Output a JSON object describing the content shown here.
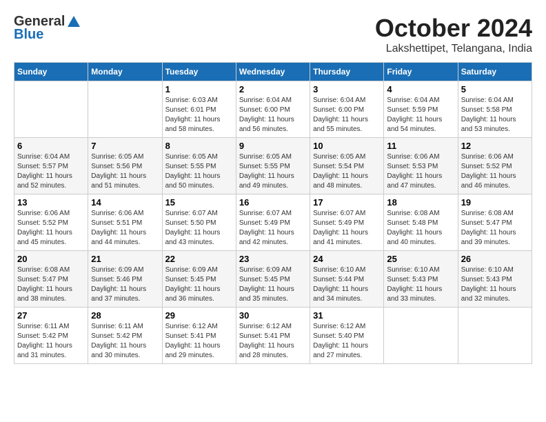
{
  "logo": {
    "general": "General",
    "blue": "Blue"
  },
  "title": "October 2024",
  "location": "Lakshettipet, Telangana, India",
  "days_of_week": [
    "Sunday",
    "Monday",
    "Tuesday",
    "Wednesday",
    "Thursday",
    "Friday",
    "Saturday"
  ],
  "weeks": [
    [
      {
        "day": null,
        "info": null
      },
      {
        "day": null,
        "info": null
      },
      {
        "day": "1",
        "info": "Sunrise: 6:03 AM\nSunset: 6:01 PM\nDaylight: 11 hours\nand 58 minutes."
      },
      {
        "day": "2",
        "info": "Sunrise: 6:04 AM\nSunset: 6:00 PM\nDaylight: 11 hours\nand 56 minutes."
      },
      {
        "day": "3",
        "info": "Sunrise: 6:04 AM\nSunset: 6:00 PM\nDaylight: 11 hours\nand 55 minutes."
      },
      {
        "day": "4",
        "info": "Sunrise: 6:04 AM\nSunset: 5:59 PM\nDaylight: 11 hours\nand 54 minutes."
      },
      {
        "day": "5",
        "info": "Sunrise: 6:04 AM\nSunset: 5:58 PM\nDaylight: 11 hours\nand 53 minutes."
      }
    ],
    [
      {
        "day": "6",
        "info": "Sunrise: 6:04 AM\nSunset: 5:57 PM\nDaylight: 11 hours\nand 52 minutes."
      },
      {
        "day": "7",
        "info": "Sunrise: 6:05 AM\nSunset: 5:56 PM\nDaylight: 11 hours\nand 51 minutes."
      },
      {
        "day": "8",
        "info": "Sunrise: 6:05 AM\nSunset: 5:55 PM\nDaylight: 11 hours\nand 50 minutes."
      },
      {
        "day": "9",
        "info": "Sunrise: 6:05 AM\nSunset: 5:55 PM\nDaylight: 11 hours\nand 49 minutes."
      },
      {
        "day": "10",
        "info": "Sunrise: 6:05 AM\nSunset: 5:54 PM\nDaylight: 11 hours\nand 48 minutes."
      },
      {
        "day": "11",
        "info": "Sunrise: 6:06 AM\nSunset: 5:53 PM\nDaylight: 11 hours\nand 47 minutes."
      },
      {
        "day": "12",
        "info": "Sunrise: 6:06 AM\nSunset: 5:52 PM\nDaylight: 11 hours\nand 46 minutes."
      }
    ],
    [
      {
        "day": "13",
        "info": "Sunrise: 6:06 AM\nSunset: 5:52 PM\nDaylight: 11 hours\nand 45 minutes."
      },
      {
        "day": "14",
        "info": "Sunrise: 6:06 AM\nSunset: 5:51 PM\nDaylight: 11 hours\nand 44 minutes."
      },
      {
        "day": "15",
        "info": "Sunrise: 6:07 AM\nSunset: 5:50 PM\nDaylight: 11 hours\nand 43 minutes."
      },
      {
        "day": "16",
        "info": "Sunrise: 6:07 AM\nSunset: 5:49 PM\nDaylight: 11 hours\nand 42 minutes."
      },
      {
        "day": "17",
        "info": "Sunrise: 6:07 AM\nSunset: 5:49 PM\nDaylight: 11 hours\nand 41 minutes."
      },
      {
        "day": "18",
        "info": "Sunrise: 6:08 AM\nSunset: 5:48 PM\nDaylight: 11 hours\nand 40 minutes."
      },
      {
        "day": "19",
        "info": "Sunrise: 6:08 AM\nSunset: 5:47 PM\nDaylight: 11 hours\nand 39 minutes."
      }
    ],
    [
      {
        "day": "20",
        "info": "Sunrise: 6:08 AM\nSunset: 5:47 PM\nDaylight: 11 hours\nand 38 minutes."
      },
      {
        "day": "21",
        "info": "Sunrise: 6:09 AM\nSunset: 5:46 PM\nDaylight: 11 hours\nand 37 minutes."
      },
      {
        "day": "22",
        "info": "Sunrise: 6:09 AM\nSunset: 5:45 PM\nDaylight: 11 hours\nand 36 minutes."
      },
      {
        "day": "23",
        "info": "Sunrise: 6:09 AM\nSunset: 5:45 PM\nDaylight: 11 hours\nand 35 minutes."
      },
      {
        "day": "24",
        "info": "Sunrise: 6:10 AM\nSunset: 5:44 PM\nDaylight: 11 hours\nand 34 minutes."
      },
      {
        "day": "25",
        "info": "Sunrise: 6:10 AM\nSunset: 5:43 PM\nDaylight: 11 hours\nand 33 minutes."
      },
      {
        "day": "26",
        "info": "Sunrise: 6:10 AM\nSunset: 5:43 PM\nDaylight: 11 hours\nand 32 minutes."
      }
    ],
    [
      {
        "day": "27",
        "info": "Sunrise: 6:11 AM\nSunset: 5:42 PM\nDaylight: 11 hours\nand 31 minutes."
      },
      {
        "day": "28",
        "info": "Sunrise: 6:11 AM\nSunset: 5:42 PM\nDaylight: 11 hours\nand 30 minutes."
      },
      {
        "day": "29",
        "info": "Sunrise: 6:12 AM\nSunset: 5:41 PM\nDaylight: 11 hours\nand 29 minutes."
      },
      {
        "day": "30",
        "info": "Sunrise: 6:12 AM\nSunset: 5:41 PM\nDaylight: 11 hours\nand 28 minutes."
      },
      {
        "day": "31",
        "info": "Sunrise: 6:12 AM\nSunset: 5:40 PM\nDaylight: 11 hours\nand 27 minutes."
      },
      {
        "day": null,
        "info": null
      },
      {
        "day": null,
        "info": null
      }
    ]
  ]
}
